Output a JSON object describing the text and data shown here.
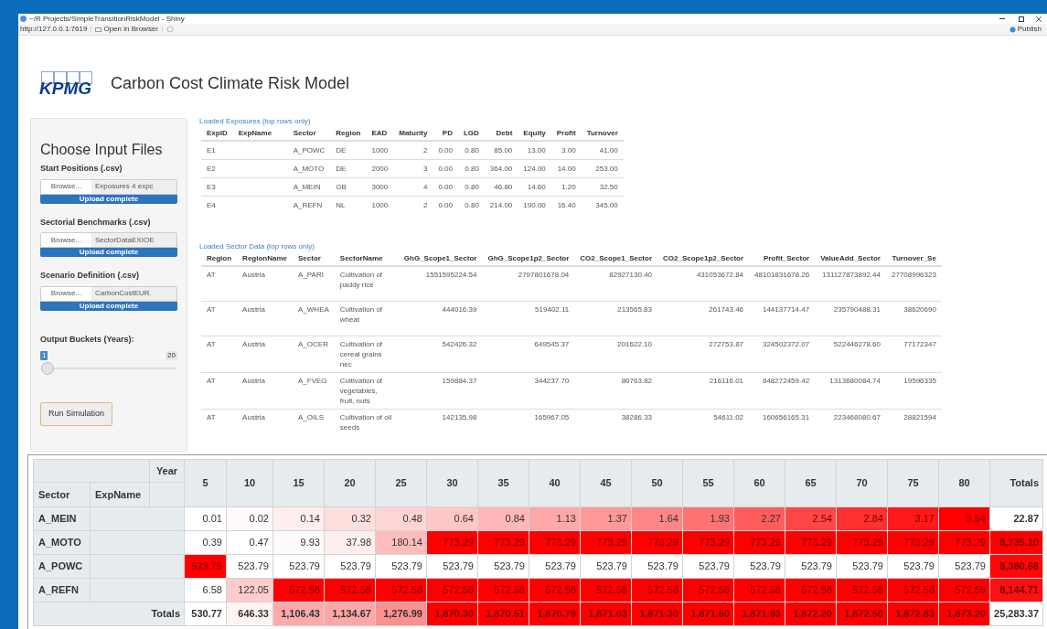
{
  "window": {
    "title": "~/R Projects/SimpleTransitionRiskModel - Shiny",
    "url": "http://127.0.0.1:7619",
    "open_in_browser": "Open in Browser",
    "publish": "Publish"
  },
  "header": {
    "logo": "KPMG",
    "title": "Carbon Cost Climate Risk Model"
  },
  "sidebar": {
    "heading": "Choose Input Files",
    "file_inputs": [
      {
        "label": "Start Positions (.csv)",
        "button": "Browse...",
        "filename": "Exposures 4 expc",
        "status": "Upload complete",
        "level": 1
      },
      {
        "label": "Sectorial Benchmarks (.csv)",
        "button": "Browse...",
        "filename": "SectorDataEXIOE",
        "status": "Upload complete",
        "level": 1
      },
      {
        "label": "Scenario Definition (.csv)",
        "button": "Browse...",
        "filename": "CarbonCostEUR.",
        "status": "Upload complete",
        "level": 1
      }
    ],
    "slider": {
      "label": "Output Buckets (Years):",
      "value": "1",
      "max": "20",
      "level": 0
    },
    "run_button": "Run Simulation"
  },
  "exposures": {
    "caption": "Loaded Exposures (top rows only)",
    "columns": [
      {
        "label": "ExpID",
        "kind": "text"
      },
      {
        "label": "ExpName",
        "kind": "redacted"
      },
      {
        "label": "Sector",
        "kind": "text"
      },
      {
        "label": "Region",
        "kind": "text"
      },
      {
        "label": "EAD",
        "kind": "text"
      },
      {
        "label": "Maturity",
        "kind": "number"
      },
      {
        "label": "PD",
        "kind": "number"
      },
      {
        "label": "LGD",
        "kind": "number"
      },
      {
        "label": "Debt",
        "kind": "number"
      },
      {
        "label": "Equity",
        "kind": "number"
      },
      {
        "label": "Profit",
        "kind": "number"
      },
      {
        "label": "Turnover",
        "kind": "number"
      }
    ],
    "rows": [
      [
        "E1",
        "",
        "A_POWC",
        "DE",
        "1000",
        "2",
        "0.00",
        "0.80",
        "85.00",
        "13.00",
        "3.00",
        "41.00"
      ],
      [
        "E2",
        "",
        "A_MOTO",
        "DE",
        "2000",
        "3",
        "0.00",
        "0.80",
        "364.00",
        "124.00",
        "14.00",
        "253.00"
      ],
      [
        "E3",
        "",
        "A_MEIN",
        "GB",
        "3000",
        "4",
        "0.00",
        "0.80",
        "46.80",
        "14.60",
        "1.20",
        "32.50"
      ],
      [
        "E4",
        "",
        "A_REFN",
        "NL",
        "1000",
        "2",
        "0.00",
        "0.80",
        "214.00",
        "190.00",
        "16.40",
        "345.00"
      ]
    ]
  },
  "sector_data": {
    "caption": "Loaded Sector Data (top rows only)",
    "columns": [
      {
        "label": "Region",
        "kind": "text"
      },
      {
        "label": "RegionName",
        "kind": "text"
      },
      {
        "label": "Sector",
        "kind": "text"
      },
      {
        "label": "SectorName",
        "kind": "text"
      },
      {
        "label": "GhG_Scope1_Sector",
        "kind": "number"
      },
      {
        "label": "GhG_Scope1p2_Sector",
        "kind": "number"
      },
      {
        "label": "CO2_Scope1_Sector",
        "kind": "number"
      },
      {
        "label": "CO2_Scope1p2_Sector",
        "kind": "number"
      },
      {
        "label": "Profit_Sector",
        "kind": "number"
      },
      {
        "label": "ValueAdd_Sector",
        "kind": "number"
      },
      {
        "label": "Turnover_Se",
        "kind": "number"
      }
    ],
    "rows": [
      [
        "AT",
        "Austria",
        "A_PARI",
        "Cultivation of paddy rice",
        "1551595224.54",
        "2797801678.04",
        "82927130.40",
        "431053672.84",
        "48101831678.26",
        "131127873892.44",
        "27708996323"
      ],
      [
        "AT",
        "Austria",
        "A_WHEA",
        "Cultivation of wheat",
        "444016.39",
        "519402.11",
        "213565.83",
        "261743.46",
        "144137714.47",
        "235790488.31",
        "38620690"
      ],
      [
        "AT",
        "Austria",
        "A_OCER",
        "Cultivation of cereal grains nec",
        "542426.32",
        "649545.37",
        "201622.10",
        "272753.87",
        "324502372.07",
        "522446278.60",
        "77172347"
      ],
      [
        "AT",
        "Austria",
        "A_FVEG",
        "Cultivation of vegetables, fruit, nuts",
        "159884.37",
        "344237.70",
        "80763.82",
        "216116.01",
        "848272459.42",
        "1313680084.74",
        "19596335"
      ],
      [
        "AT",
        "Austria",
        "A_OILS",
        "Cultivation of oil seeds",
        "142135.98",
        "165967.05",
        "38286.33",
        "54611.02",
        "160656165.31",
        "223468080.67",
        "28821594"
      ]
    ]
  },
  "pivot": {
    "corner_label": "Year",
    "row_headers": [
      "Sector",
      "ExpName"
    ],
    "years": [
      "5",
      "10",
      "15",
      "20",
      "25",
      "30",
      "35",
      "40",
      "45",
      "50",
      "55",
      "60",
      "65",
      "70",
      "75",
      "80"
    ],
    "totals_label": "Totals",
    "rows": [
      {
        "sector": "A_MEIN",
        "cells": [
          {
            "value": "0.01",
            "color": "#ffffff"
          },
          {
            "value": "0.02",
            "color": "#fffafa"
          },
          {
            "value": "0.14",
            "color": "#ffeeee"
          },
          {
            "value": "0.32",
            "color": "#ffdede"
          },
          {
            "value": "0.48",
            "color": "#ffd4d4"
          },
          {
            "value": "0.64",
            "color": "#ffc6c6"
          },
          {
            "value": "0.84",
            "color": "#ffb8b8"
          },
          {
            "value": "1.13",
            "color": "#ffa8a8"
          },
          {
            "value": "1.37",
            "color": "#ff9898"
          },
          {
            "value": "1.64",
            "color": "#ff8686"
          },
          {
            "value": "1.93",
            "color": "#ff7272"
          },
          {
            "value": "2.27",
            "color": "#ff5c5c"
          },
          {
            "value": "2.54",
            "color": "#ff4646"
          },
          {
            "value": "2.84",
            "color": "#ff3030"
          },
          {
            "value": "3.17",
            "color": "#ff1a1a"
          },
          {
            "value": "3.54",
            "color": "#ff0000"
          }
        ],
        "total": {
          "value": "22.87",
          "color": "#ffffff"
        }
      },
      {
        "sector": "A_MOTO",
        "cells": [
          {
            "value": "0.39",
            "color": "#ffffff"
          },
          {
            "value": "0.47",
            "color": "#ffffff"
          },
          {
            "value": "9.93",
            "color": "#fffafa"
          },
          {
            "value": "37.98",
            "color": "#ffeeee"
          },
          {
            "value": "180.14",
            "color": "#ffbcbc"
          },
          {
            "value": "773.29",
            "color": "#ff0000"
          },
          {
            "value": "773.29",
            "color": "#ff0000"
          },
          {
            "value": "773.29",
            "color": "#ff0000"
          },
          {
            "value": "773.29",
            "color": "#ff0000"
          },
          {
            "value": "773.29",
            "color": "#ff0000"
          },
          {
            "value": "773.29",
            "color": "#ff0000"
          },
          {
            "value": "773.29",
            "color": "#ff0000"
          },
          {
            "value": "773.29",
            "color": "#ff0000"
          },
          {
            "value": "773.29",
            "color": "#ff0000"
          },
          {
            "value": "773.29",
            "color": "#ff0000"
          },
          {
            "value": "773.29",
            "color": "#ff0000"
          }
        ],
        "total": {
          "value": "8,735.10",
          "color": "#ff0000"
        }
      },
      {
        "sector": "A_POWC",
        "cells": [
          {
            "value": "523.79",
            "color": "#ff0000"
          },
          {
            "value": "523.79",
            "color": "#ffffff"
          },
          {
            "value": "523.79",
            "color": "#ffffff"
          },
          {
            "value": "523.79",
            "color": "#ffffff"
          },
          {
            "value": "523.79",
            "color": "#ffffff"
          },
          {
            "value": "523.79",
            "color": "#ffffff"
          },
          {
            "value": "523.79",
            "color": "#ffffff"
          },
          {
            "value": "523.79",
            "color": "#ffffff"
          },
          {
            "value": "523.79",
            "color": "#ffffff"
          },
          {
            "value": "523.79",
            "color": "#ffffff"
          },
          {
            "value": "523.79",
            "color": "#ffffff"
          },
          {
            "value": "523.79",
            "color": "#ffffff"
          },
          {
            "value": "523.79",
            "color": "#ffffff"
          },
          {
            "value": "523.79",
            "color": "#ffffff"
          },
          {
            "value": "523.79",
            "color": "#ffffff"
          },
          {
            "value": "523.79",
            "color": "#ffffff"
          }
        ],
        "total": {
          "value": "8,380.68",
          "color": "#ff0808"
        }
      },
      {
        "sector": "A_REFN",
        "cells": [
          {
            "value": "6.58",
            "color": "#ffffff"
          },
          {
            "value": "122.05",
            "color": "#ffcccc"
          },
          {
            "value": "572.58",
            "color": "#ff0000"
          },
          {
            "value": "572.58",
            "color": "#ff0000"
          },
          {
            "value": "572.58",
            "color": "#ff0000"
          },
          {
            "value": "572.58",
            "color": "#ff0000"
          },
          {
            "value": "572.58",
            "color": "#ff0000"
          },
          {
            "value": "572.58",
            "color": "#ff0000"
          },
          {
            "value": "572.58",
            "color": "#ff0000"
          },
          {
            "value": "572.58",
            "color": "#ff0000"
          },
          {
            "value": "572.58",
            "color": "#ff0000"
          },
          {
            "value": "572.58",
            "color": "#ff0000"
          },
          {
            "value": "572.58",
            "color": "#ff0000"
          },
          {
            "value": "572.58",
            "color": "#ff0000"
          },
          {
            "value": "572.58",
            "color": "#ff0000"
          },
          {
            "value": "572.58",
            "color": "#ff0000"
          }
        ],
        "total": {
          "value": "8,144.71",
          "color": "#ff1010"
        }
      }
    ],
    "totals_row": {
      "label": "Totals",
      "cells": [
        {
          "value": "530.77",
          "color": "#ffffff"
        },
        {
          "value": "646.33",
          "color": "#fff4f4"
        },
        {
          "value": "1,106.43",
          "color": "#ffaaaa"
        },
        {
          "value": "1,134.67",
          "color": "#ffa6a6"
        },
        {
          "value": "1,276.99",
          "color": "#ff9090"
        },
        {
          "value": "1,870.30",
          "color": "#ff0000"
        },
        {
          "value": "1,870.51",
          "color": "#ff0000"
        },
        {
          "value": "1,870.79",
          "color": "#ff0000"
        },
        {
          "value": "1,871.03",
          "color": "#ff0000"
        },
        {
          "value": "1,871.30",
          "color": "#ff0000"
        },
        {
          "value": "1,871.60",
          "color": "#ff0000"
        },
        {
          "value": "1,871.93",
          "color": "#ff0000"
        },
        {
          "value": "1,872.20",
          "color": "#ff0000"
        },
        {
          "value": "1,872.50",
          "color": "#ff0000"
        },
        {
          "value": "1,872.83",
          "color": "#ff0000"
        },
        {
          "value": "1,873.20",
          "color": "#ff0000"
        }
      ],
      "total": {
        "value": "25,283.37",
        "color": "#ffffff"
      }
    }
  }
}
